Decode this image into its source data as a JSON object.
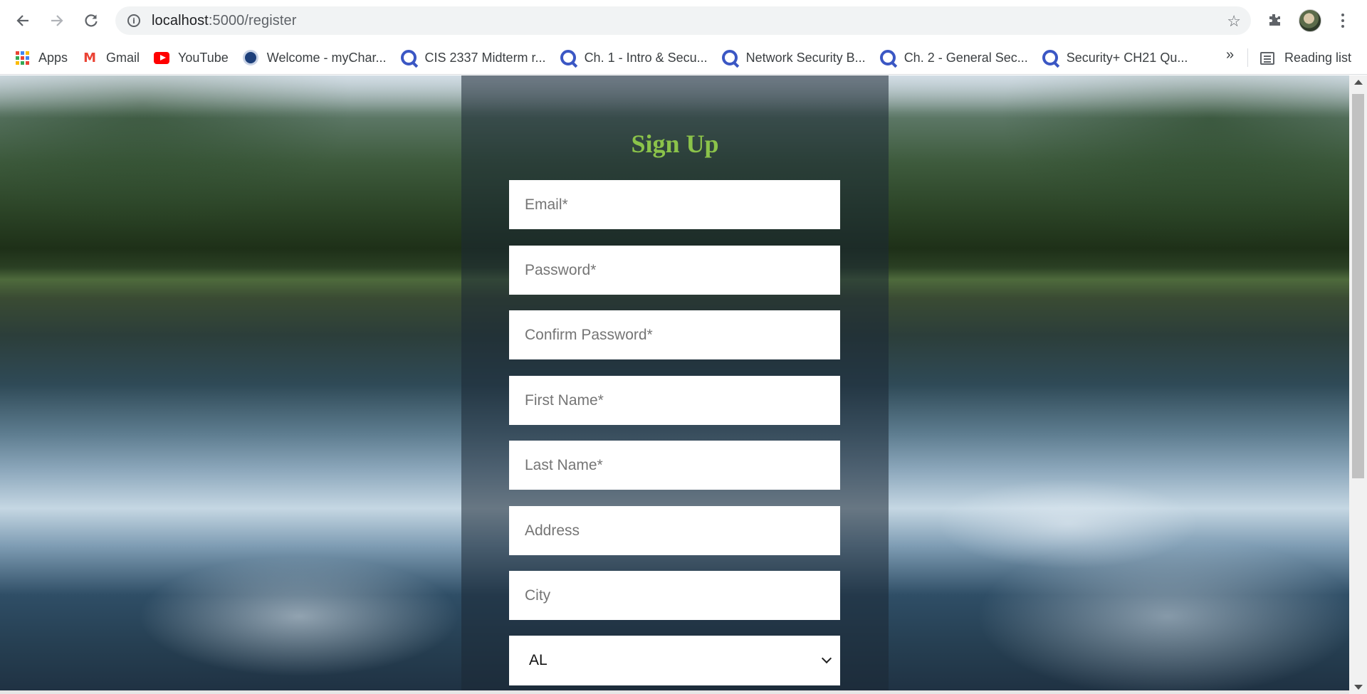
{
  "browser": {
    "url_host": "localhost",
    "url_path": ":5000/register",
    "reading_list_label": "Reading list",
    "overflow_label": "»"
  },
  "bookmarks": [
    {
      "label": "Apps",
      "icon": "apps-grid-icon"
    },
    {
      "label": "Gmail",
      "icon": "gmail-icon"
    },
    {
      "label": "YouTube",
      "icon": "youtube-icon"
    },
    {
      "label": "Welcome - myChar...",
      "icon": "seal-icon"
    },
    {
      "label": "CIS 2337 Midterm r...",
      "icon": "quizlet-icon"
    },
    {
      "label": "Ch. 1 - Intro & Secu...",
      "icon": "quizlet-icon"
    },
    {
      "label": "Network Security B...",
      "icon": "quizlet-icon"
    },
    {
      "label": "Ch. 2 - General Sec...",
      "icon": "quizlet-icon"
    },
    {
      "label": "Security+ CH21 Qu...",
      "icon": "quizlet-icon"
    }
  ],
  "form": {
    "title": "Sign Up",
    "email_placeholder": "Email*",
    "password_placeholder": "Password*",
    "confirm_password_placeholder": "Confirm Password*",
    "first_name_placeholder": "First Name*",
    "last_name_placeholder": "Last Name*",
    "address_placeholder": "Address",
    "city_placeholder": "City",
    "state_selected": "AL"
  },
  "colors": {
    "title": "#8bc34a",
    "panel": "rgba(28, 40, 52, 0.55)",
    "quizlet": "#3b57c4"
  }
}
